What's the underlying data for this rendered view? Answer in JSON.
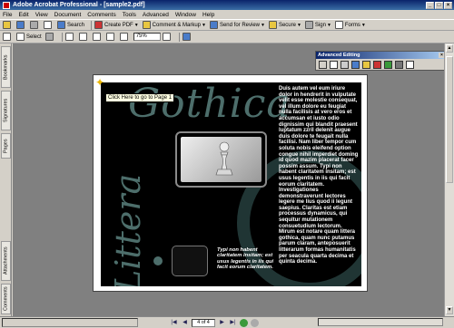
{
  "window": {
    "title": "Adobe Acrobat Professional - [sample2.pdf]",
    "controls": [
      "_",
      "□",
      "×"
    ]
  },
  "menu": {
    "items": [
      "File",
      "Edit",
      "View",
      "Document",
      "Comments",
      "Tools",
      "Advanced",
      "Window",
      "Help"
    ]
  },
  "toolbar": {
    "search_label": "Search",
    "create_pdf_label": "Create PDF",
    "comment_label": "Comment & Markup",
    "send_review_label": "Send for Review",
    "secure_label": "Secure",
    "sign_label": "Sign",
    "forms_label": "Forms",
    "select_label": "Select",
    "zoom_value": "75%"
  },
  "left_tabs": [
    "Bookmarks",
    "Signatures",
    "Pages",
    "Attachments",
    "Comments"
  ],
  "advanced_editing": {
    "title": "Advanced Editing",
    "close": "×"
  },
  "document": {
    "tooltip": "Click Here to go to Page 1",
    "heading_top": "Gothica",
    "heading_vertical": "Littera",
    "body_text": "Duis autem vel eum iriure dolor in hendrerit in vulputate velit esse molestie consequat, vel illum dolore eu feugiat nulla facilisis at vero eros et accumsan et iusto odio dignissim qui blandit praesent luptatum zzril delenit augue duis dolore te feugait nulla facilisi. Nam liber tempor cum soluta nobis eleifend option congue nihil imperdiet doming id quod mazim placerat facer possim assum. Typi non habent claritatem insitam; est usus legentis in iis qui facit eorum claritatem. Investigationes demonstraverunt lectores legere me lius quod ii legunt saepius. Claritas est etiam processus dynamicus, qui sequitur mutationem consuetudium lectorum. Mirum est notare quam littera gothica, quam nunc putamus parum claram, anteposuerit litterarum formas humanitatis per seacula quarta decima et quinta decima.",
    "italic_text": "Typi non habent claritatem insitam; est usus legentis in iis qui facit eorum claritatem."
  },
  "status": {
    "page_indicator": "4 of 4",
    "nav_first": "|◀",
    "nav_prev": "◀",
    "nav_next": "▶",
    "nav_last": "▶|"
  },
  "colors": {
    "title_bar": "#0a246a",
    "ornament": "#4d6e6b",
    "page_background": "#000000"
  }
}
